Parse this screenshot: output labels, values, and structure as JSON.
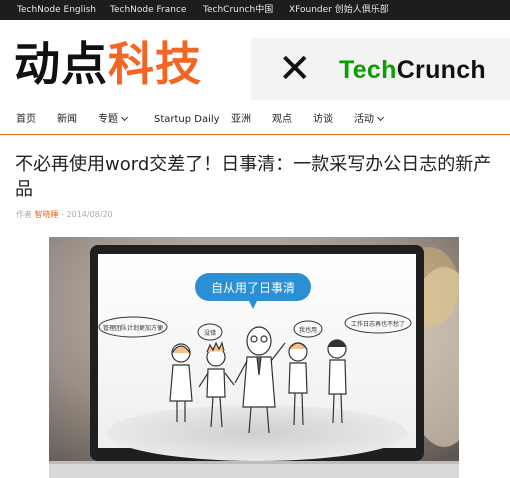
{
  "topbar": {
    "links": [
      "TechNode English",
      "TechNode France",
      "TechCrunch中国",
      "XFounder 创始人俱乐部"
    ]
  },
  "logo": {
    "part1": "动点",
    "part2": "科技"
  },
  "banner": {
    "mark": "✕",
    "brand_green": "Tech",
    "brand_black": "Crunch"
  },
  "nav": {
    "items": [
      {
        "label": "首页",
        "dropdown": false
      },
      {
        "label": "新闻",
        "dropdown": false
      },
      {
        "label": "专题",
        "dropdown": true
      },
      {
        "label": "Startup Daily",
        "dropdown": false
      },
      {
        "label": "亚洲",
        "dropdown": false
      },
      {
        "label": "观点",
        "dropdown": false
      },
      {
        "label": "访谈",
        "dropdown": false
      },
      {
        "label": "活动",
        "dropdown": true
      }
    ]
  },
  "article": {
    "title": "不必再使用word交差了！日事清：一款采写办公日志的新产品",
    "author_prefix": "作者",
    "author": "智晓睡",
    "date": " - 2014/08/20"
  },
  "illustration": {
    "bubble_main": "自从用了日事清",
    "bubble_left": "管理团队计划更加方便",
    "bubble_mid_left": "没错",
    "bubble_mid_right": "我也用",
    "bubble_right": "工作日志再也不愁了"
  },
  "colors": {
    "accent": "#f26522",
    "topbar": "#1d1d1d",
    "tc_green": "#0a9e01",
    "bubble_blue": "#2b8fd6"
  }
}
